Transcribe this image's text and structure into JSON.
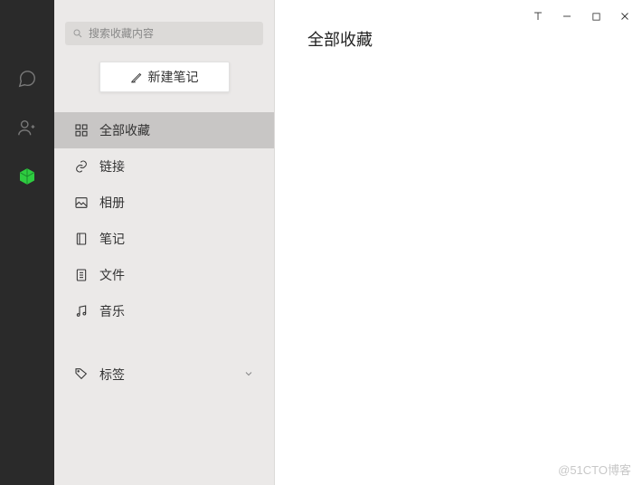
{
  "search": {
    "placeholder": "搜索收藏内容"
  },
  "new_note_label": "新建笔记",
  "menu": {
    "all": "全部收藏",
    "links": "链接",
    "album": "相册",
    "notes": "笔记",
    "files": "文件",
    "music": "音乐"
  },
  "tags_label": "标签",
  "main": {
    "title": "全部收藏"
  },
  "watermark": "@51CTO博客"
}
